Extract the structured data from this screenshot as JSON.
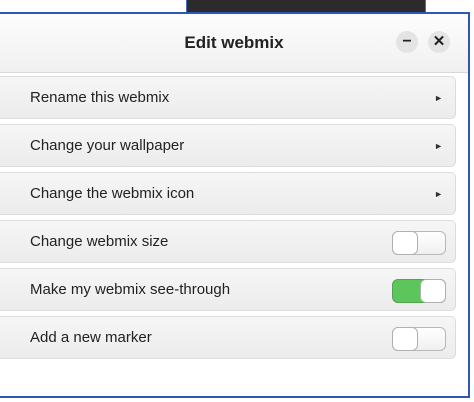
{
  "dialog": {
    "title": "Edit webmix",
    "minimize_symbol": "−",
    "close_symbol": "✕"
  },
  "options": [
    {
      "label": "Rename this webmix",
      "control": "submenu"
    },
    {
      "label": "Change your wallpaper",
      "control": "submenu"
    },
    {
      "label": "Change the webmix icon",
      "control": "submenu"
    },
    {
      "label": "Change webmix size",
      "control": "toggle",
      "on": false
    },
    {
      "label": "Make my webmix see-through",
      "control": "toggle",
      "on": true
    },
    {
      "label": "Add a new marker",
      "control": "toggle",
      "on": false
    }
  ],
  "colors": {
    "toggle_on": "#5cc55c",
    "border_accent": "#2f55b5"
  },
  "icons": {
    "submenu": "triangle-right-icon"
  }
}
